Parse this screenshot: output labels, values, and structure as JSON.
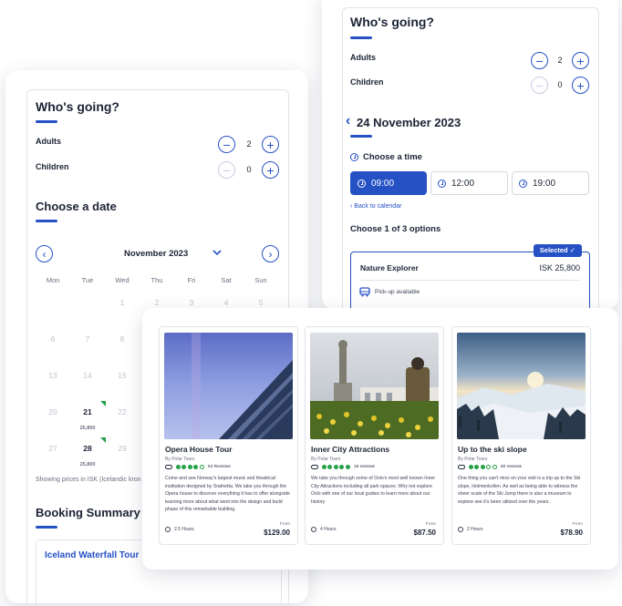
{
  "left_widget": {
    "whos_going": {
      "title": "Who's going?",
      "adults_label": "Adults",
      "adults_count": "2",
      "children_label": "Children",
      "children_count": "0",
      "minus": "−",
      "plus": "+"
    },
    "choose_date": {
      "title": "Choose a date",
      "month": "November 2023",
      "weekdays": [
        "Mon",
        "Tue",
        "Wed",
        "Thu",
        "Fri",
        "Sat",
        "Sun"
      ],
      "days": [
        "1",
        "2",
        "3",
        "4",
        "5",
        "6",
        "7",
        "8",
        "13",
        "14",
        "15",
        "20",
        "21",
        "22",
        "27",
        "28",
        "29"
      ],
      "day_21_price": "25,800",
      "day_28_price": "25,800",
      "currency_note": "Showing prices in ISK (Icelandic kron"
    },
    "booking_summary": {
      "title": "Booking Summary",
      "tour_name": "Iceland Waterfall Tour"
    }
  },
  "right_widget": {
    "whos_going": {
      "title": "Who's going?",
      "adults_label": "Adults",
      "adults_count": "2",
      "children_label": "Children",
      "children_count": "0",
      "minus": "−",
      "plus": "+"
    },
    "date_title": "24 November 2023",
    "back_chevron": "‹",
    "choose_time_label": "Choose a time",
    "times": [
      "09:00",
      "12:00",
      "19:00"
    ],
    "back_to_calendar": "‹ Back to calendar",
    "options_title": "Choose 1 of 3 options",
    "selected_badge": "Selected ✓",
    "option_name": "Nature Explorer",
    "option_price": "ISK 25,800",
    "pickup_label": "Pick-up available"
  },
  "tours": [
    {
      "title": "Opera House Tour",
      "by": "By Polar Tours",
      "rating": 4,
      "reviews": "54 Reviews",
      "description": "Come and see Norway's largest music and theatrical institution designed by Snøhetta. We take you through the Opera house to discover everything it has to offer alongside learning more about what went into the design and build phase of this remarkable building.",
      "duration": "2.5 Hours",
      "from_label": "From",
      "price": "$129.00"
    },
    {
      "title": "Inner City Attractions",
      "by": "By Polar Tours",
      "rating": 5,
      "reviews": "19 reviews",
      "description": "We take you through some of Oslo's most well known Inner City Attractions including all park spaces. Why not explore Oslo with one of our local guides to learn more about our history",
      "duration": "4 Hours",
      "from_label": "From",
      "price": "$87.50"
    },
    {
      "title": "Up to the ski slope",
      "by": "By Polar Tours",
      "rating": 3,
      "reviews": "60 reviews",
      "description": "One thing you can't miss on your visit is a trip up to the Ski slope, Holmenkollen. As well as being able to witness the sheer scale of the Ski Jump there is also a museum to explore see it's been utilized over the years.",
      "duration": "2 Hours",
      "from_label": "From",
      "price": "$78.90"
    }
  ],
  "colors": {
    "accent": "#2551c4",
    "rating_green": "#27a04a",
    "text": "#1c2335"
  },
  "icons": [
    "minus-icon",
    "plus-icon",
    "chevron-left-icon",
    "chevron-right-icon",
    "chevron-down-icon",
    "clock-icon",
    "check-icon",
    "bus-icon",
    "tripadvisor-owl-icon"
  ]
}
